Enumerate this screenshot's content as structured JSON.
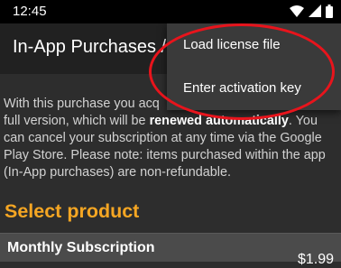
{
  "status_bar": {
    "time": "12:45",
    "icons": [
      "wifi-icon",
      "signal-icon",
      "battery-icon"
    ]
  },
  "toolbar": {
    "title": "In-App Purchases / "
  },
  "overflow_menu": {
    "items": [
      {
        "label": "Load license file"
      },
      {
        "label": "Enter activation key"
      }
    ]
  },
  "description": {
    "part1": "With this purchase you acq",
    "part2": "full version, which will be ",
    "bold": "renewed automatically",
    "part3": ". You can cancel your subscription at any time via the Google Play Store. Please note: items purchased within the app (In-App purchases) are non-refundable."
  },
  "section": {
    "title": "Select product"
  },
  "products": [
    {
      "name": "Monthly Subscription",
      "price": "$1.99"
    }
  ],
  "colors": {
    "accent": "#f5a623",
    "annotation": "#e8141c",
    "background": "#2d2d2d",
    "toolbar": "#212121",
    "menu": "#3a3a3a"
  }
}
